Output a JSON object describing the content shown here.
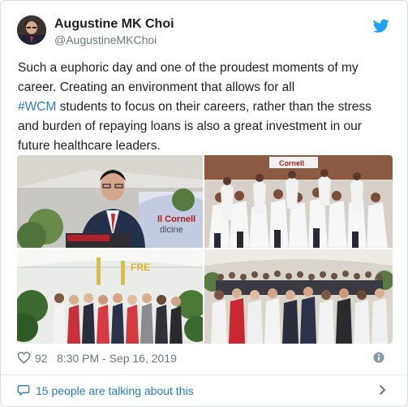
{
  "tweet": {
    "author_name": "Augustine MK Choi",
    "author_handle": "@AugustineMKChoi",
    "text_line1": "Such a euphoric day and one of the proudest moments of my",
    "text_line2": "career. Creating an environment that allows for all",
    "hashtag": "#WCM",
    "text_line3_rest": " students to focus on their careers, rather than the stress",
    "text_line4": "and burden of repaying loans is also a great investment in our",
    "text_line5": "future healthcare leaders.",
    "likes": "92",
    "timestamp": "8:30 PM - Sep 16, 2019",
    "conversation": "15 people are talking about this"
  },
  "photos": {
    "photo1_sign_line1": "ll Cornell",
    "photo1_sign_line2": "dicine",
    "photo2_banner": "Cornell",
    "photo3_balloon": "FRE"
  },
  "icons": {
    "brand_bird": "twitter-bird-icon",
    "like": "heart-icon",
    "info": "info-icon",
    "reply": "speech-bubble-icon",
    "more": "chevron-right-icon"
  },
  "colors": {
    "link_blue": "#2b7bb9",
    "twitter_blue": "#1da1f2",
    "muted_gray": "#697882",
    "text_dark": "#1c2022"
  }
}
